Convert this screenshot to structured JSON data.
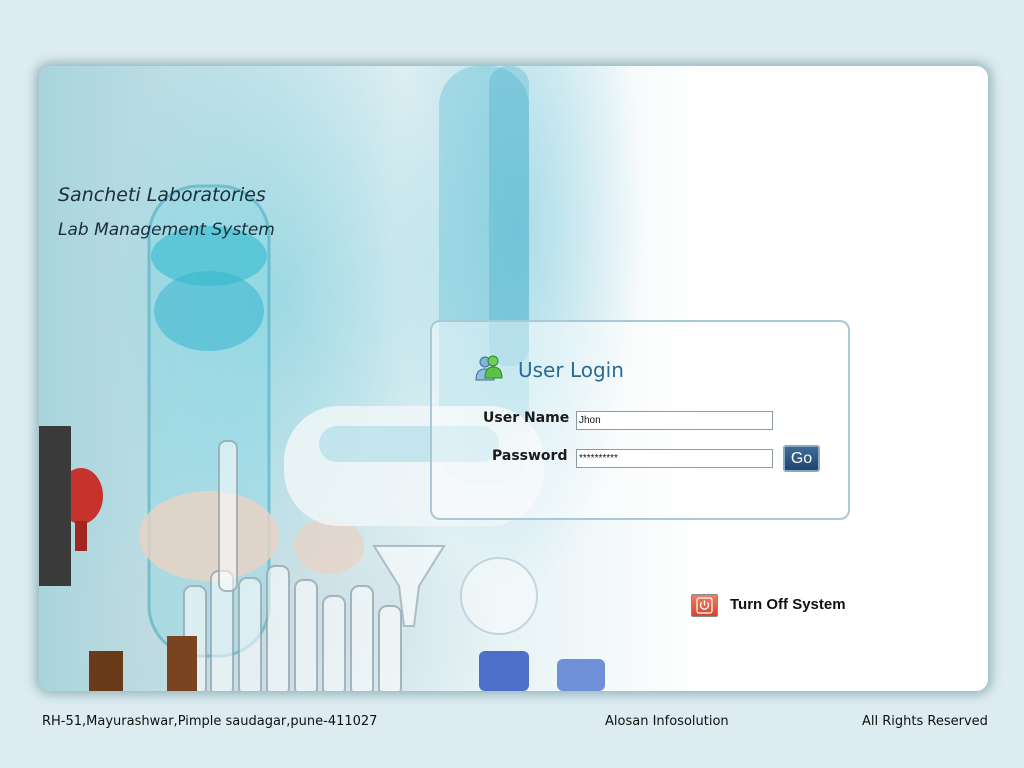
{
  "brand": {
    "company": "Sancheti Laboratories",
    "system": "Lab Management System"
  },
  "login": {
    "title": "User Login",
    "username_label": "User Name",
    "username_value": "Jhon",
    "password_label": "Password",
    "password_value": "**********",
    "go_label": "Go",
    "icon": "users-icon"
  },
  "power": {
    "label": "Turn Off System",
    "icon": "power-icon"
  },
  "footer": {
    "address": "RH-51,Mayurashwar,Pimple saudagar,pune-411027",
    "company": "Alosan Infosolution",
    "rights": "All Rights Reserved"
  },
  "colors": {
    "accent": "#2a6a93",
    "go_button": "#2b5580",
    "power_button": "#e05a3a",
    "page_bg": "#dcecf1"
  }
}
